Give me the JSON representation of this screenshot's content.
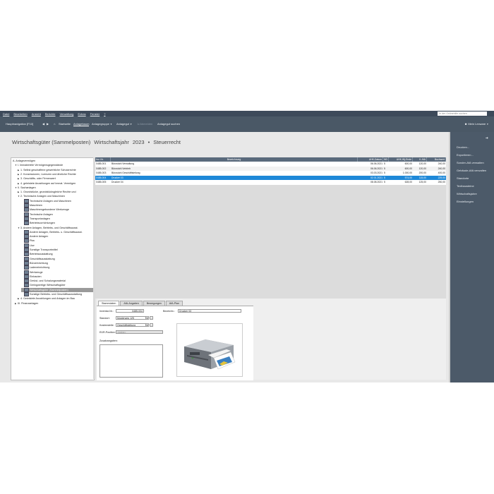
{
  "menu": [
    "Datei",
    "Bearbeiten",
    "Ansicht",
    "Berichte",
    "Verwaltung",
    "Extras",
    "Fenster",
    "?"
  ],
  "help_search_placeholder": "In der Onlinehilfe suchen",
  "toolbar": {
    "nav": "Hauptnavigation [F10]",
    "start": "Startseite",
    "tree": "Anlagebaum",
    "group": "Anlagegruppe",
    "asset": "Anlagegut",
    "disposal": "Abmelden",
    "search": "Anlagegut suchen",
    "user": "Mein Lexware"
  },
  "window": {
    "title": "Wirtschaftsgüter (Sammelposten)",
    "year_label": "Wirtschaftsjahr",
    "year": "2023",
    "law": "Steuerrecht"
  },
  "tree": [
    {
      "label": "A. Anlagevermögen",
      "level": 0,
      "arrow": "",
      "icon": false
    },
    {
      "label": "I. Immaterielle Vermögensgegenstände",
      "level": 1,
      "arrow": "▼",
      "icon": false
    },
    {
      "label": "1. Selbst geschaffene gewerbliche Schutzrechte",
      "level": 2,
      "arrow": "▶",
      "icon": false
    },
    {
      "label": "2. Konzessionen, Lizenzen und ähnliche Rechte",
      "level": 2,
      "arrow": "▶",
      "icon": false
    },
    {
      "label": "3. Geschäfts- oder Firmenwert",
      "level": 2,
      "arrow": "▶",
      "icon": false
    },
    {
      "label": "4. geleistete Anzahlungen auf immat. Vermögen",
      "level": 2,
      "arrow": "▶",
      "icon": false
    },
    {
      "label": "II. Sachanlagen",
      "level": 1,
      "arrow": "▼",
      "icon": false
    },
    {
      "label": "1. Grundstücke, grundstücksgleiche Rechte und",
      "level": 2,
      "arrow": "▶",
      "icon": false
    },
    {
      "label": "2. Technische Anlagen und Maschinen",
      "level": 2,
      "arrow": "▼",
      "icon": false
    },
    {
      "label": "Technische Anlagen und Maschinen",
      "level": 3,
      "arrow": "",
      "icon": true
    },
    {
      "label": "Maschinen",
      "level": 3,
      "arrow": "",
      "icon": true
    },
    {
      "label": "Maschinengebundene Werkzeuge",
      "level": 3,
      "arrow": "",
      "icon": true
    },
    {
      "label": "Technische Anlagen",
      "level": 3,
      "arrow": "",
      "icon": true
    },
    {
      "label": "Transportanlagen",
      "level": 3,
      "arrow": "",
      "icon": true
    },
    {
      "label": "Betriebsvorrichtungen",
      "level": 3,
      "arrow": "",
      "icon": true
    },
    {
      "label": "3. Andere Anlagen, Betriebs- und Geschäftsausst.",
      "level": 2,
      "arrow": "▼",
      "icon": false
    },
    {
      "label": "Andere Anlagen, Betriebs- u. Geschäftsausst.",
      "level": 3,
      "arrow": "",
      "icon": true
    },
    {
      "label": "Andere Anlagen",
      "level": 3,
      "arrow": "",
      "icon": true
    },
    {
      "label": "Pkw",
      "level": 3,
      "arrow": "",
      "icon": true
    },
    {
      "label": "Lkw",
      "level": 3,
      "arrow": "",
      "icon": true
    },
    {
      "label": "Sonstige Transportmittel",
      "level": 3,
      "arrow": "",
      "icon": true
    },
    {
      "label": "Betriebsausstattung",
      "level": 3,
      "arrow": "",
      "icon": true
    },
    {
      "label": "Geschäftsausstattung",
      "level": 3,
      "arrow": "",
      "icon": true
    },
    {
      "label": "Büroeinrichtung",
      "level": 3,
      "arrow": "",
      "icon": true
    },
    {
      "label": "Ladeneinrichtung",
      "level": 3,
      "arrow": "",
      "icon": true
    },
    {
      "label": "Werkzeuge",
      "level": 3,
      "arrow": "",
      "icon": true
    },
    {
      "label": "Einbauten",
      "level": 3,
      "arrow": "",
      "icon": true
    },
    {
      "label": "Gerüst- und Schalungsmaterial",
      "level": 3,
      "arrow": "",
      "icon": true
    },
    {
      "label": "Geringwertige Wirtschaftsgüter",
      "level": 3,
      "arrow": "",
      "icon": true
    },
    {
      "label": "Wirtschaftsgüter (Sammelposten)",
      "level": 3,
      "arrow": "",
      "icon": true,
      "selected": true
    },
    {
      "label": "Sonstige Betriebs- und Geschäftsausstattung",
      "level": 3,
      "arrow": "",
      "icon": true
    },
    {
      "label": "4. Geleistete Anzahlungen und Anlagen im Bau",
      "level": 2,
      "arrow": "▶",
      "icon": false
    },
    {
      "label": "III. Finanzanlagen",
      "level": 1,
      "arrow": "▶",
      "icon": false
    }
  ],
  "grid": {
    "headers": [
      "Inv.-Nr.",
      "Bezeichnung",
      "AHK-Datum",
      "ND",
      "AHK-Wj-Ende",
      "Il. AfA",
      "Buchwert"
    ],
    "rows": [
      [
        "0485-001",
        "Bürostuhl Verwaltung",
        "06.06.2021",
        "5",
        "600,00",
        "120,00",
        "240,00"
      ],
      [
        "0485-002",
        "Bürostuhl Vertrieb",
        "06.06.2021",
        "5",
        "600,00",
        "120,00",
        "240,00"
      ],
      [
        "0485-003",
        "Bürostuhl Geschäftsleitung",
        "03.03.2021",
        "5",
        "1.000,00",
        "200,00",
        "400,00"
      ],
      [
        "0485-004",
        "Drucker 03",
        "02.01.2021",
        "5",
        "574,00",
        "115,00",
        "229,00"
      ],
      [
        "0485-005",
        "Drucker 04",
        "08.08.2021",
        "5",
        "628,00",
        "125,00",
        "250,00"
      ]
    ],
    "selected_row": 3
  },
  "detail": {
    "tabs": [
      "Stammdaten",
      "AfA-Angaben",
      "Bewegungen",
      "AfA-Plan"
    ],
    "inv_label": "Inventar-Nr.:",
    "inv_value": "0485-004",
    "bez_label": "Bezeichn.:",
    "bez_value": "Drucker 03",
    "standort_label": "Standort:",
    "standort_value": "Musterweg 125",
    "kostenstelle_label": "Kostenstelle:",
    "kostenstelle_value": "Geschäftsleitung",
    "eur_label": "EÜR-Position:",
    "eur_value": "<keine>",
    "zusatz_label": "Zusatzangaben:"
  },
  "sidebar": {
    "items": [
      "Drucken...",
      "Exportieren...",
      "Sonder-AfA verwalten",
      "Gebäude-AfA verwalten",
      "Standorte",
      "Textbausteine",
      "Wirtschaftsjahre",
      "Einstellungen"
    ]
  }
}
